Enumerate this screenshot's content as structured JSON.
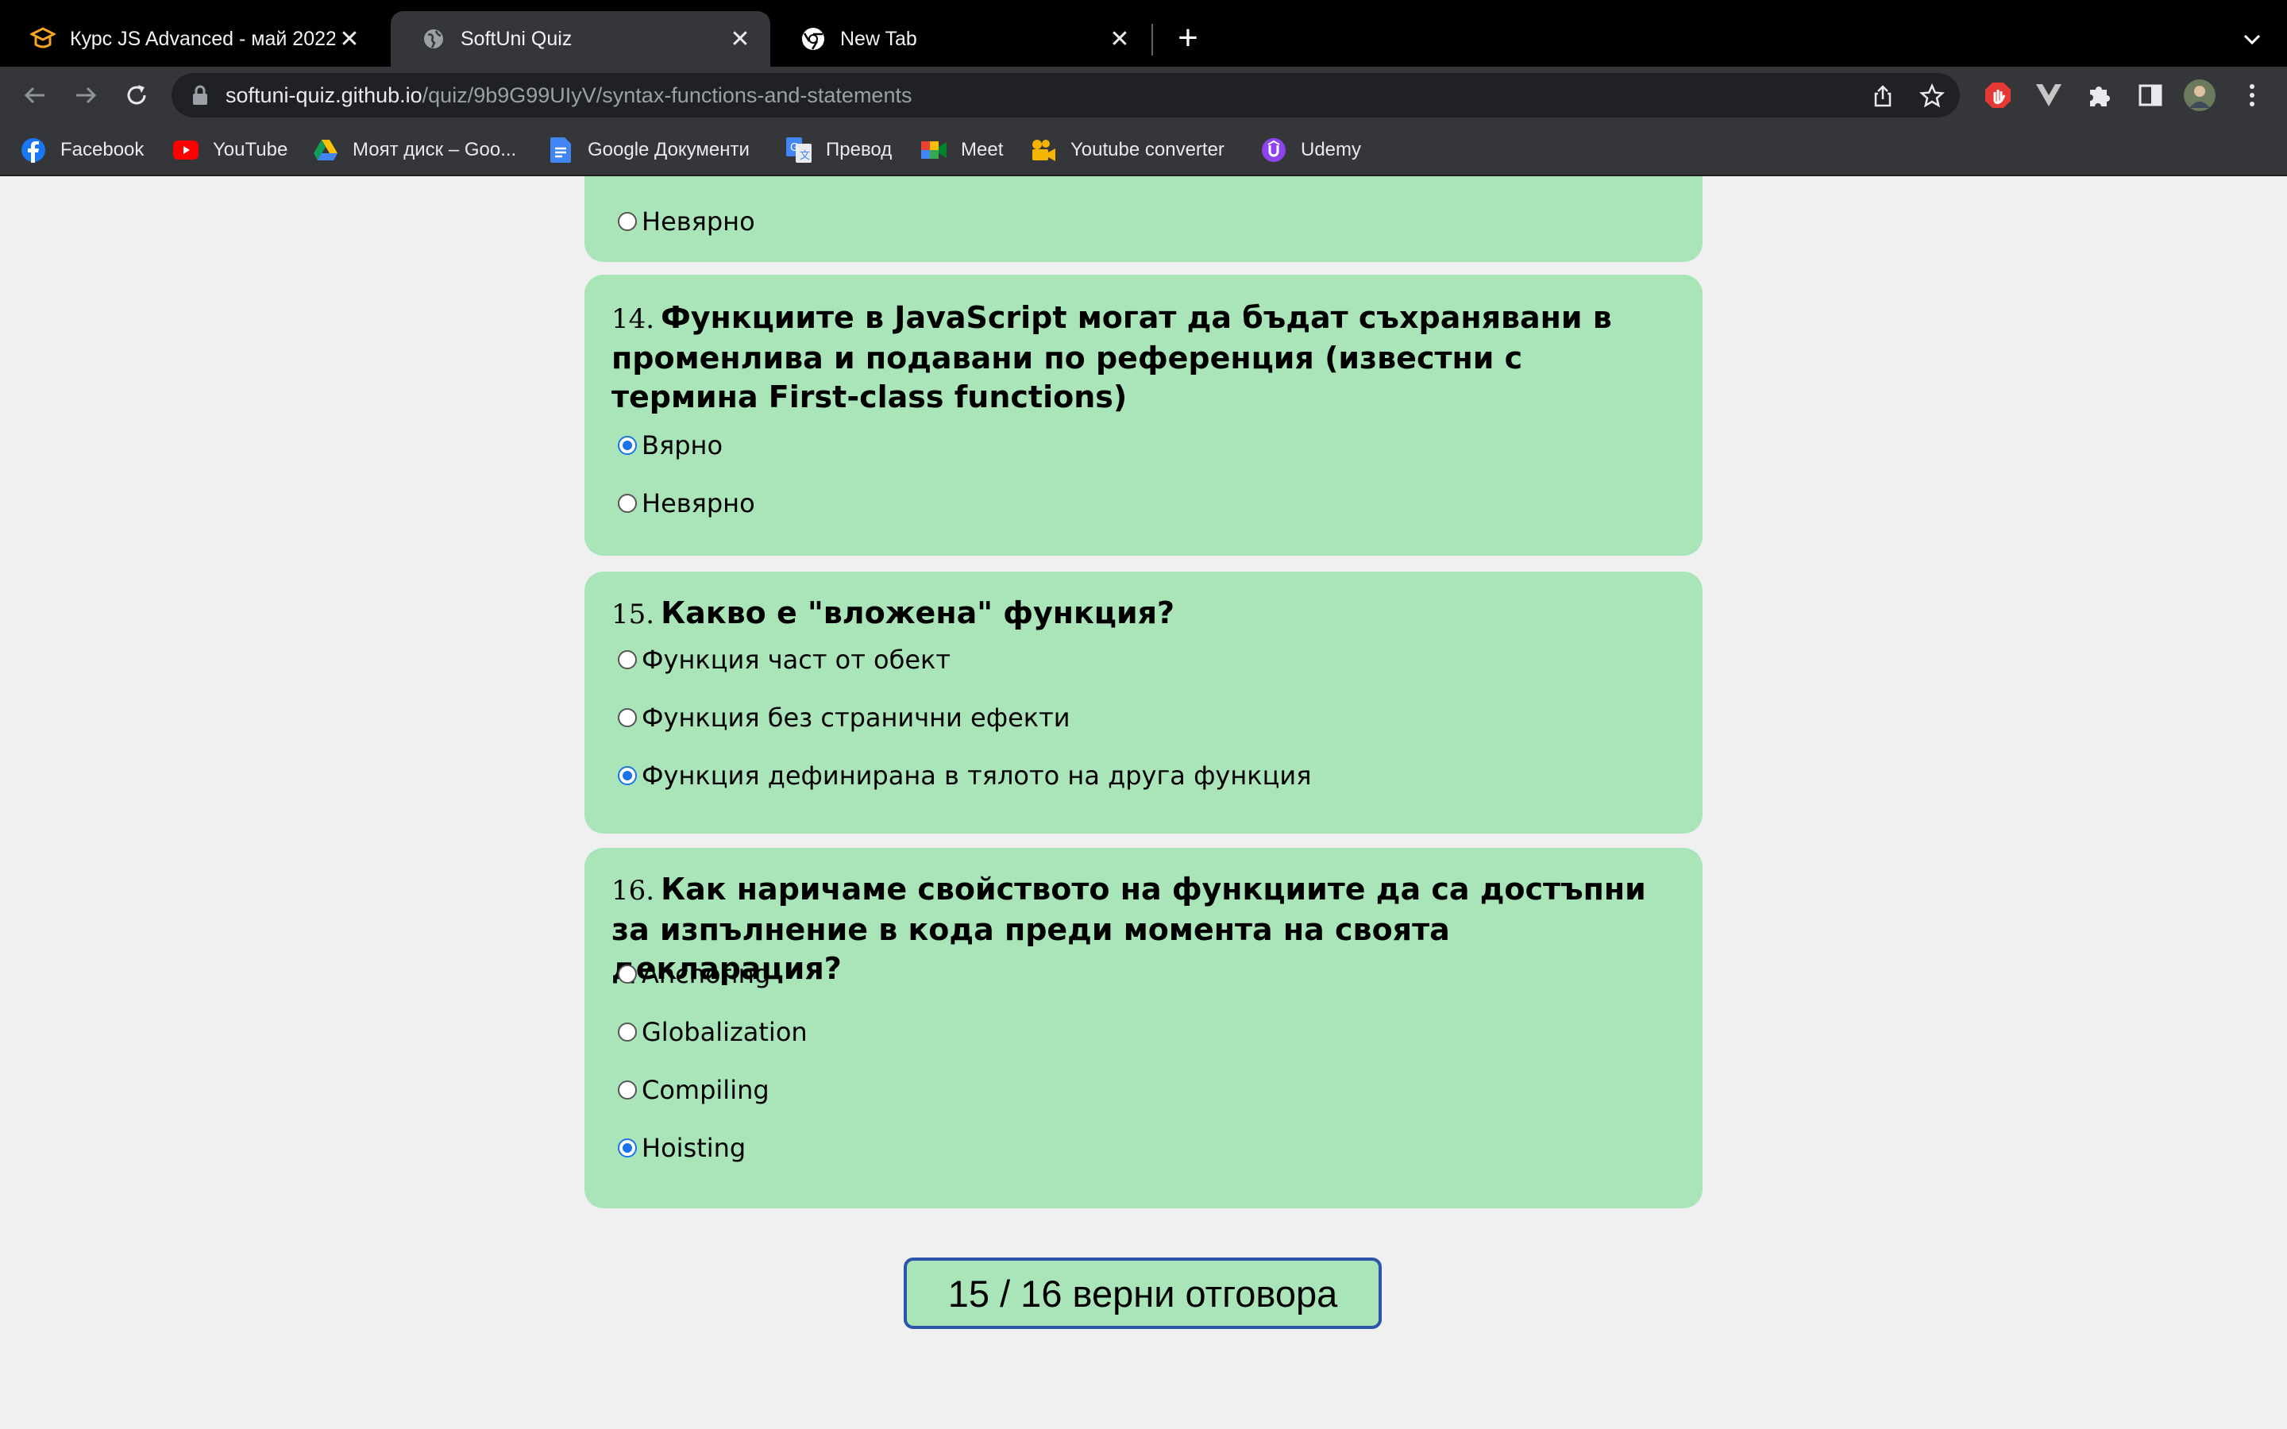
{
  "browser": {
    "tabs": [
      {
        "title": "Курс JS Advanced - май 2022",
        "favicon": "softuni-logo-icon",
        "active": false
      },
      {
        "title": "SoftUni Quiz",
        "favicon": "globe-icon",
        "active": true
      },
      {
        "title": "New Tab",
        "favicon": "chrome-icon",
        "active": false
      }
    ],
    "url_host": "softuni-quiz.github.io",
    "url_path": "/quiz/9b9G99UIyV/syntax-functions-and-statements",
    "bookmarks": [
      {
        "label": "Facebook",
        "icon": "facebook-icon"
      },
      {
        "label": "YouTube",
        "icon": "youtube-icon"
      },
      {
        "label": "Моят диск – Goo...",
        "icon": "google-drive-icon"
      },
      {
        "label": "Google Документи",
        "icon": "google-docs-icon"
      },
      {
        "label": "Превод",
        "icon": "google-translate-icon"
      },
      {
        "label": "Meet",
        "icon": "google-meet-icon"
      },
      {
        "label": "Youtube converter",
        "icon": "camera-icon"
      },
      {
        "label": "Udemy",
        "icon": "udemy-icon"
      }
    ]
  },
  "quiz": {
    "prev_card": {
      "options": [
        {
          "label": "Невярно",
          "checked": false
        }
      ]
    },
    "questions": [
      {
        "number": "14.",
        "text": "Функциите в JavaScript могат да бъдат съхранявани в променлива и подавани по референция (известни с термина First-class functions)",
        "options": [
          {
            "label": "Вярно",
            "checked": true
          },
          {
            "label": "Невярно",
            "checked": false
          }
        ]
      },
      {
        "number": "15.",
        "text": "Какво е \"вложена\" функция?",
        "options": [
          {
            "label": "Функция част от обект",
            "checked": false
          },
          {
            "label": "Функция без странични ефекти",
            "checked": false
          },
          {
            "label": "Функция дефинирана в тялото на друга функция",
            "checked": true
          }
        ]
      },
      {
        "number": "16.",
        "text": "Как наричаме свойството на функциите да са достъпни за изпълнение в кода преди момента на своята декларация?",
        "options": [
          {
            "label": "Anchoring",
            "checked": false
          },
          {
            "label": "Globalization",
            "checked": false
          },
          {
            "label": "Compiling",
            "checked": false
          },
          {
            "label": "Hoisting",
            "checked": true
          }
        ]
      }
    ],
    "score": "15 / 16 верни отговора"
  },
  "colors": {
    "card_bg": "#aae4b9",
    "page_bg": "#f0f0f0",
    "accent": "#1a73e8",
    "score_border": "#2a55a8"
  }
}
